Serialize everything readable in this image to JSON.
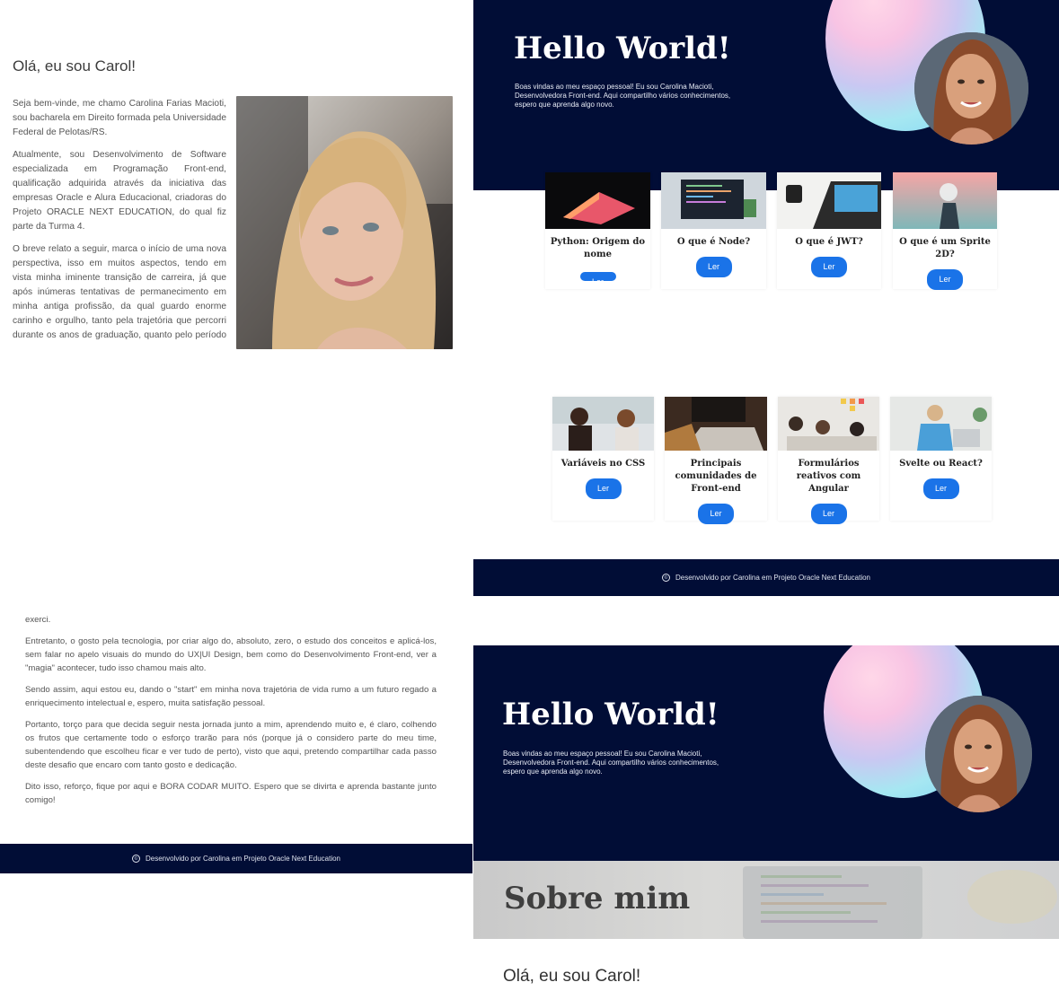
{
  "about": {
    "heading": "Olá, eu sou Carol!",
    "paragraphs": [
      "Seja bem-vinde, me chamo Carolina Farias Macioti, sou bacharela em Direito formada pela Universidade Federal de Pelotas/RS.",
      "Atualmente, sou Desenvolvimento de Software especializada em Programação Front-end, qualificação adquirida através da iniciativa das empresas Oracle e Alura Educacional, criadoras do Projeto ORACLE NEXT EDUCATION, do qual fiz parte da Turma 4.",
      "O breve relato a seguir, marca o início de uma nova perspectiva, isso em muitos aspectos, tendo em vista minha iminente transição de carreira, já que após inúmeras tentativas de permanecimento em minha antiga profissão, da qual guardo enorme carinho e orgulho, tanto pela trajetória que percorri durante os anos de graduação, quanto pelo período em que a"
    ],
    "continuation": [
      "exerci.",
      "Entretanto, o gosto pela tecnologia, por criar algo do, absoluto, zero, o estudo dos conceitos e aplicá-los, sem falar no apelo visuais do mundo do UX|UI Design, bem como do Desenvolvimento Front-end, ver a \"magia\" acontecer, tudo isso chamou mais alto.",
      "Sendo assim, aqui estou eu, dando o \"start\" em minha nova trajetória de vida rumo a um futuro regado a enriquecimento intelectual e, espero, muita satisfação pessoal.",
      "Portanto, torço para que decida seguir nesta jornada junto a mim, aprendendo muito e, é claro, colhendo os frutos que certamente todo o esforço trarão para nós (porque já o considero parte do meu time, subentendendo que escolheu ficar e ver tudo de perto), visto que aqui, pretendo compartilhar cada passo deste desafio que encaro com tanto gosto e dedicação.",
      "Dito isso, reforço, fique por aqui e BORA CODAR MUITO. Espero que se divirta e aprenda bastante junto comigo!"
    ]
  },
  "footer": {
    "text": "Desenvolvido por Carolina em Projeto Oracle Next Education"
  },
  "footer_full": {
    "text": "Desenvolvido por Carolina em Projeto Oracle Next Education"
  },
  "hero": {
    "title": "Hello World!",
    "subtitle_lines": [
      "Boas vindas ao meu espaço pessoal! Eu sou Carolina Macioti,",
      "Desenvolvedora Front-end. Aqui compartilho vários conhecimentos,",
      "espero que aprenda algo novo."
    ]
  },
  "cards_row1": [
    {
      "title": "Python: Origem do nome",
      "button": "Ler"
    },
    {
      "title": "O que é Node?",
      "button": "Ler"
    },
    {
      "title": "O que é JWT?",
      "button": "Ler"
    },
    {
      "title": "O que é um Sprite 2D?",
      "button": "Ler"
    }
  ],
  "cards_row2": [
    {
      "title": "Variáveis no CSS",
      "button": "Ler"
    },
    {
      "title": "Principais comunidades de Front-end",
      "button": "Ler"
    },
    {
      "title": "Formulários reativos com Angular",
      "button": "Ler"
    },
    {
      "title": "Svelte ou React?",
      "button": "Ler"
    }
  ],
  "sobre": {
    "title": "Sobre mim",
    "greeting": "Olá, eu sou Carol!"
  },
  "colors": {
    "navy": "#010d36",
    "button_blue": "#1a73e8"
  }
}
